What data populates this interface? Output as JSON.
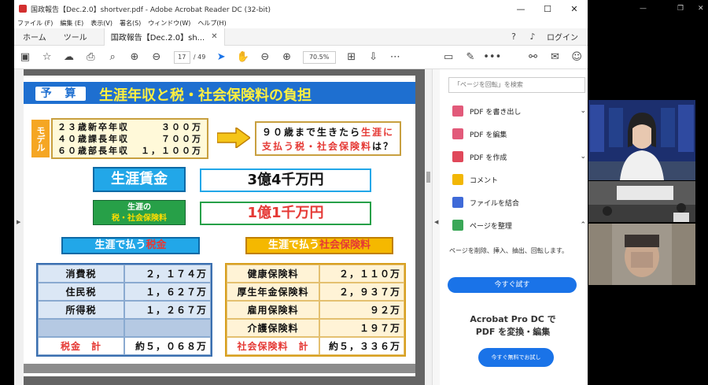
{
  "window": {
    "title": "国政報告【Dec.2.0】shortver.pdf - Adobe Acrobat Reader DC (32-bit)",
    "minimize": "—",
    "maximize": "☐",
    "close": "✕"
  },
  "menu": [
    "ファイル (F)",
    "編集 (E)",
    "表示(V)",
    "署名(S)",
    "ウィンドウ(W)",
    "ヘルプ(H)"
  ],
  "tabs": {
    "home": "ホーム",
    "tools": "ツール",
    "document": "国政報告【Dec.2.0】sh...",
    "close": "✕",
    "login": "ログイン"
  },
  "toolbar": {
    "current_page": "17",
    "total_pages": "/ 49",
    "zoom": "70.5%"
  },
  "slide": {
    "badge": "予 算",
    "title": "生涯年収と税・社会保険料の負担",
    "model_label": "モデル",
    "model_rows": [
      {
        "label": "２３歳新卒年収",
        "value": "３００万"
      },
      {
        "label": "４０歳課長年収",
        "value": "７００万"
      },
      {
        "label": "６０歳部長年収",
        "value": "１，１００万"
      }
    ],
    "question_line1_a": "９０歳まで生きたら",
    "question_line1_b": "生涯に",
    "question_line2_a": "支払う税・社会保険料",
    "question_line2_b": "は？",
    "wage_label": "生涯賃金",
    "wage_value": "3億4千万円",
    "lifetime_label_1": "生涯の",
    "lifetime_label_2": "税・社会保険料",
    "lifetime_value": "1億1千万円",
    "tax_head_a": "生涯で払う",
    "tax_head_b": "税金",
    "ss_head_a": "生涯で払う",
    "ss_head_b": "社会保険料",
    "tax_rows": [
      {
        "label": "消費税",
        "value": "２，１７４万"
      },
      {
        "label": "住民税",
        "value": "１，６２７万"
      },
      {
        "label": "所得税",
        "value": "１，２６７万"
      }
    ],
    "tax_total_label": "税金　計",
    "tax_total_value": "約５，０６８万",
    "ss_rows": [
      {
        "label": "健康保険料",
        "value": "２，１１０万"
      },
      {
        "label": "厚生年金保険料",
        "value": "２，９３７万"
      },
      {
        "label": "雇用保険料",
        "value": "９２万"
      },
      {
        "label": "介護保険料",
        "value": "１９７万"
      }
    ],
    "ss_total_label": "社会保険料　計",
    "ss_total_value": "約５，３３６万"
  },
  "right_panel": {
    "search_placeholder": "「ページを回転」を検索",
    "items": [
      {
        "label": "PDF を書き出し",
        "color": "#e25a7a"
      },
      {
        "label": "PDF を編集",
        "color": "#e25a7a"
      },
      {
        "label": "PDF を作成",
        "color": "#e0485a"
      },
      {
        "label": "コメント",
        "color": "#f2b705"
      },
      {
        "label": "ファイルを結合",
        "color": "#3f6ad8"
      },
      {
        "label": "ページを整理",
        "color": "#3aa757"
      }
    ],
    "organize_desc": "ページを削除、挿入、抽出、回転します。",
    "try_now": "今すぐ試す",
    "promo_line1": "Acrobat Pro DC で",
    "promo_line2": "PDF を変換・編集",
    "free_try": "今すぐ無料でお試し"
  }
}
